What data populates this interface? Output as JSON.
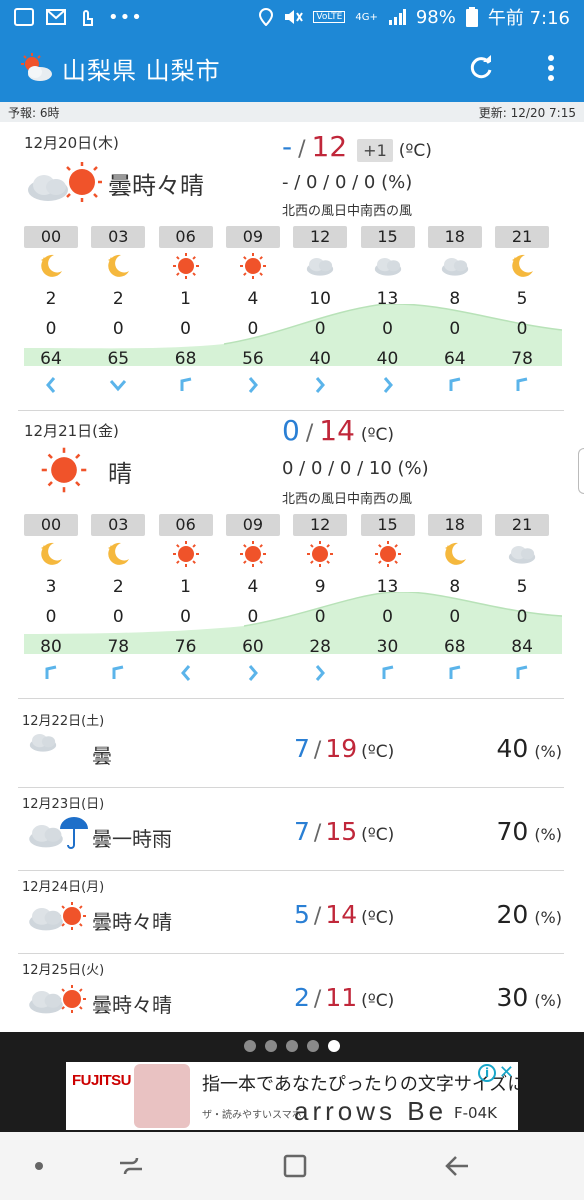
{
  "status_bar": {
    "battery": "98%",
    "time": "午前 7:16",
    "network": "4G+",
    "volte": "VoLTE",
    "more": "•••"
  },
  "app_bar": {
    "title": "山梨県 山梨市",
    "icons": [
      "weather-logo-icon",
      "refresh-icon",
      "more-vert-icon"
    ]
  },
  "info_bar": {
    "forecast_label": "予報: 6時",
    "updated_label": "更新: 12/20 7:15"
  },
  "days": [
    {
      "date": "12月20日(木)",
      "icon": "cloud-sun-icon",
      "weather": "曇時々晴",
      "temp_min": "-",
      "temp_max": "12",
      "temp_diff": "+1",
      "temp_unit": "(ºC)",
      "precip": "- / 0 / 0 / 0 (%)",
      "wind": "北西の風日中南西の風",
      "hours": [
        "00",
        "03",
        "06",
        "09",
        "12",
        "15",
        "18",
        "21"
      ],
      "hour_icons": [
        "moon-icon",
        "moon-icon",
        "sun-icon",
        "sun-icon",
        "cloud-icon",
        "cloud-icon",
        "cloud-icon",
        "moon-icon"
      ],
      "temps": [
        "2",
        "2",
        "1",
        "4",
        "10",
        "13",
        "8",
        "5"
      ],
      "precip_mm": [
        "0",
        "0",
        "0",
        "0",
        "0",
        "0",
        "0",
        "0"
      ],
      "humidity": [
        "64",
        "65",
        "68",
        "56",
        "40",
        "40",
        "64",
        "78"
      ],
      "wind_arrows": [
        "arrow-left-icon",
        "arrow-down-icon",
        "arrow-up-left-icon",
        "arrow-right-icon",
        "arrow-right-icon",
        "arrow-right-icon",
        "arrow-up-left-icon",
        "arrow-up-left-icon"
      ]
    },
    {
      "date": "12月21日(金)",
      "icon": "sun-icon",
      "weather": "晴",
      "temp_min": "0",
      "temp_max": "14",
      "temp_unit": "(ºC)",
      "precip": "0 / 0 / 0 / 10 (%)",
      "wind": "北西の風日中南西の風",
      "hours": [
        "00",
        "03",
        "06",
        "09",
        "12",
        "15",
        "18",
        "21"
      ],
      "hour_icons": [
        "moon-icon",
        "moon-icon",
        "sun-icon",
        "sun-icon",
        "sun-icon",
        "sun-icon",
        "moon-icon",
        "cloud-icon"
      ],
      "temps": [
        "3",
        "2",
        "1",
        "4",
        "9",
        "13",
        "8",
        "5"
      ],
      "precip_mm": [
        "0",
        "0",
        "0",
        "0",
        "0",
        "0",
        "0",
        "0"
      ],
      "humidity": [
        "80",
        "78",
        "76",
        "60",
        "28",
        "30",
        "68",
        "84"
      ],
      "wind_arrows": [
        "arrow-up-left-icon",
        "arrow-up-left-icon",
        "arrow-left-icon",
        "arrow-right-icon",
        "arrow-right-icon",
        "arrow-up-left-icon",
        "arrow-up-left-icon",
        "arrow-up-left-icon"
      ]
    }
  ],
  "weekly": [
    {
      "date": "12月22日(土)",
      "icon": "cloud-icon",
      "weather": "曇",
      "min": "7",
      "max": "19",
      "temp_unit": "(ºC)",
      "pop": "40",
      "pop_unit": "(%)"
    },
    {
      "date": "12月23日(日)",
      "icon": "cloud-umbrella-icon",
      "weather": "曇一時雨",
      "min": "7",
      "max": "15",
      "temp_unit": "(ºC)",
      "pop": "70",
      "pop_unit": "(%)"
    },
    {
      "date": "12月24日(月)",
      "icon": "cloud-sun-icon",
      "weather": "曇時々晴",
      "min": "5",
      "max": "14",
      "temp_unit": "(ºC)",
      "pop": "20",
      "pop_unit": "(%)"
    },
    {
      "date": "12月25日(火)",
      "icon": "cloud-sun-icon",
      "weather": "曇時々晴",
      "min": "2",
      "max": "11",
      "temp_unit": "(ºC)",
      "pop": "30",
      "pop_unit": "(%)"
    }
  ],
  "pager": {
    "count": 5,
    "active": 4
  },
  "ad": {
    "brand": "FUJITSU",
    "headline": "指一本であなたぴったりの文字サイズに",
    "sub": "ザ・読みやすいスマホ",
    "product": "arrows Be",
    "model": "F-04K"
  },
  "colors": {
    "primary": "#1e88d6",
    "temp_min": "#2a7fd4",
    "temp_max": "#c0273a",
    "humidity_fill": "#d6f2d6",
    "sun": "#f0532a",
    "wind_arrow": "#5bb4ea"
  }
}
